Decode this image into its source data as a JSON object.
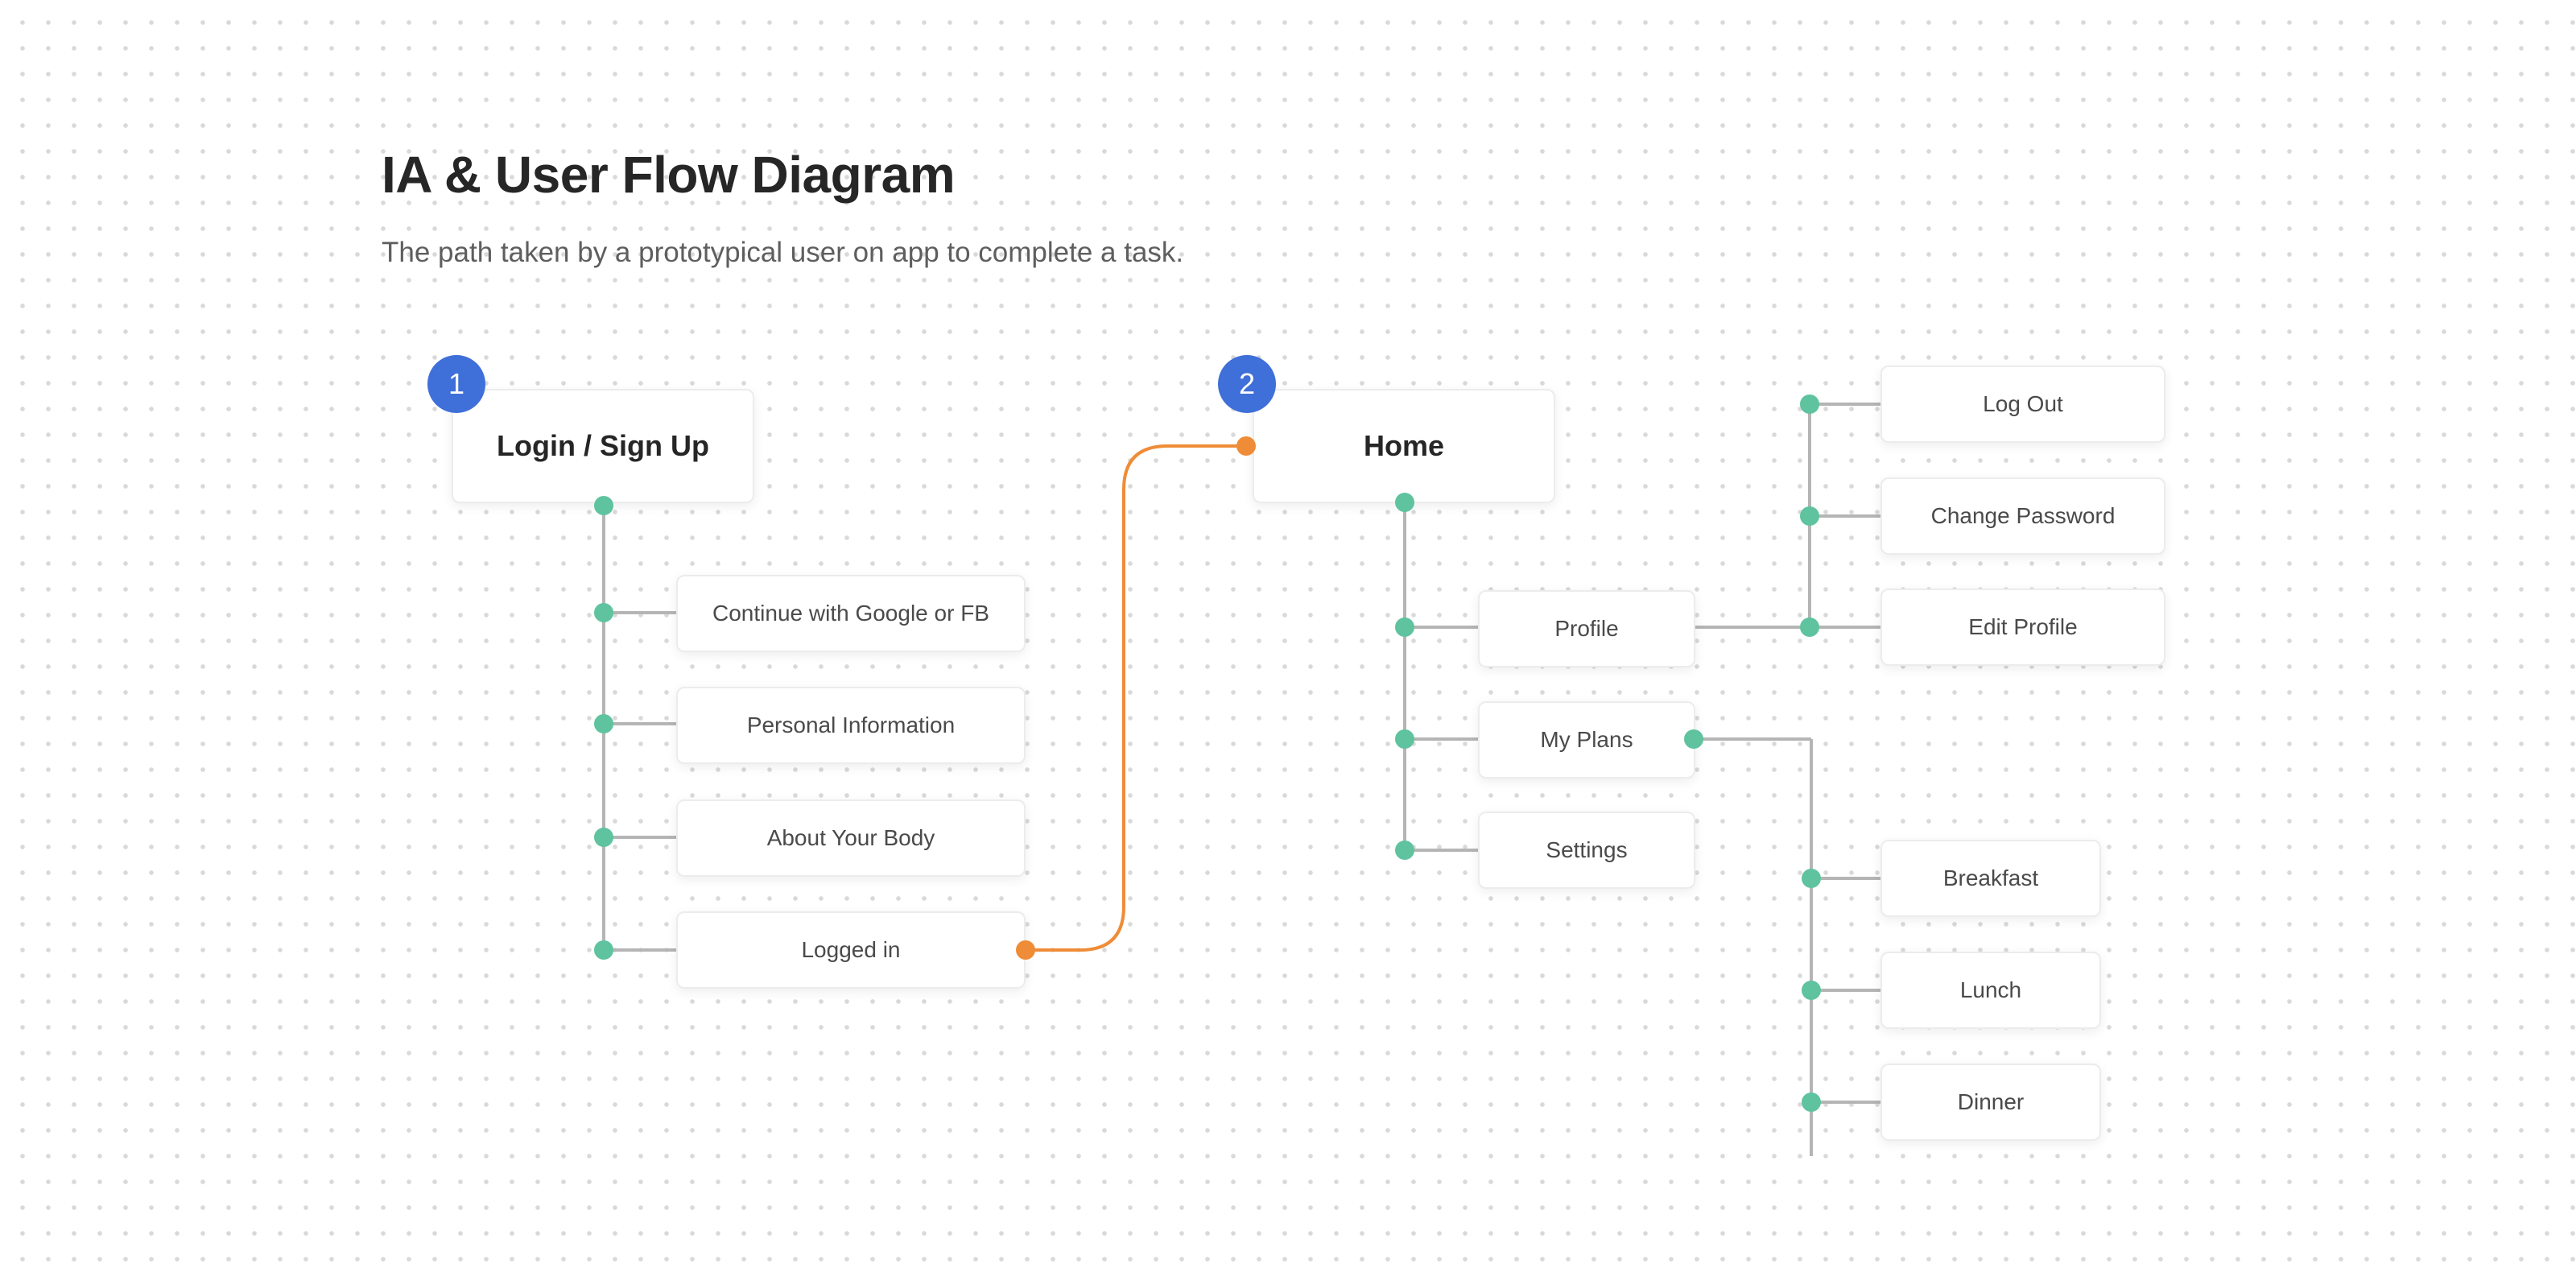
{
  "header": {
    "title": "IA & User Flow Diagram",
    "subtitle": "The path taken by a prototypical user on app to complete a task."
  },
  "colors": {
    "badge": "#3f6fd8",
    "connector_dot": "#5fc39f",
    "flow_line": "#ef8c37",
    "tree_line": "#b5b5b5"
  },
  "sections": [
    {
      "number": "1",
      "label": "Login / Sign Up",
      "children": [
        "Continue with Google or FB",
        "Personal Information",
        "About Your Body",
        "Logged in"
      ]
    },
    {
      "number": "2",
      "label": "Home",
      "children": [
        "Profile",
        "My Plans",
        "Settings"
      ],
      "profile_children": [
        "Log Out",
        "Change Password",
        "Edit Profile"
      ],
      "plans_children": [
        "Breakfast",
        "Lunch",
        "Dinner"
      ]
    }
  ],
  "flow": {
    "from": "Logged in",
    "to": "Home"
  }
}
